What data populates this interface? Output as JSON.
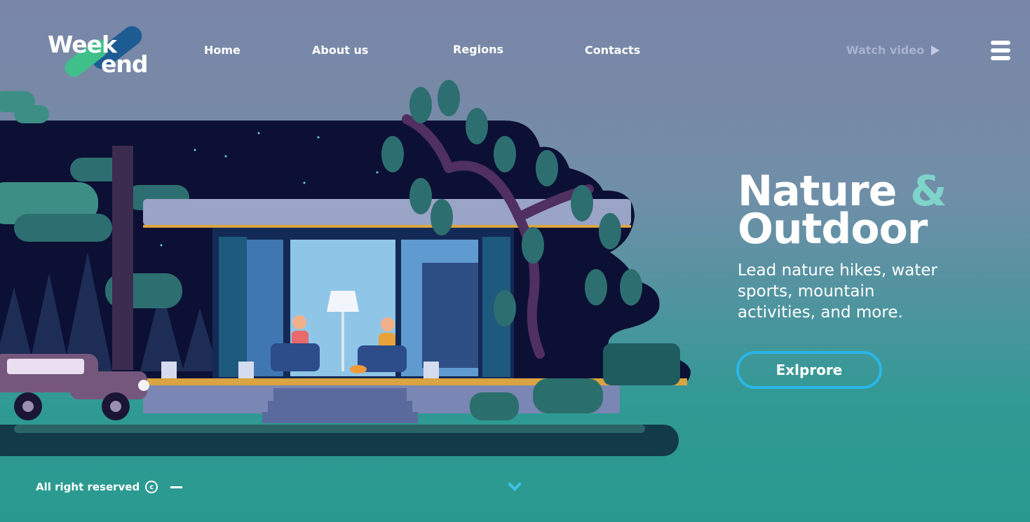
{
  "brand": {
    "logo_line1": "Week",
    "logo_line2": "end"
  },
  "nav": {
    "items": [
      {
        "label": "Home"
      },
      {
        "label": "About us"
      },
      {
        "label": "Regions"
      },
      {
        "label": "Contacts"
      }
    ],
    "watch_video": "Watch video",
    "icons": [
      "play-icon",
      "hamburger-menu-icon"
    ]
  },
  "hero": {
    "title_word1": "Nature",
    "title_amp": "&",
    "title_word2": "Outdoor",
    "subtitle": "Lead nature hikes, water sports, mountain activities, and more.",
    "cta_label": "Exlprore"
  },
  "footer": {
    "copyright": "All right reserved",
    "copyright_symbol": "c",
    "icons": [
      "copyright-icon",
      "chevron-down-icon"
    ]
  },
  "colors": {
    "accent_blue": "#2ab6e8",
    "accent_mint": "#7fd4c9",
    "logo_green": "#3fbf8a",
    "logo_navy": "#1d5c93",
    "night_sky": "#0c1034"
  }
}
